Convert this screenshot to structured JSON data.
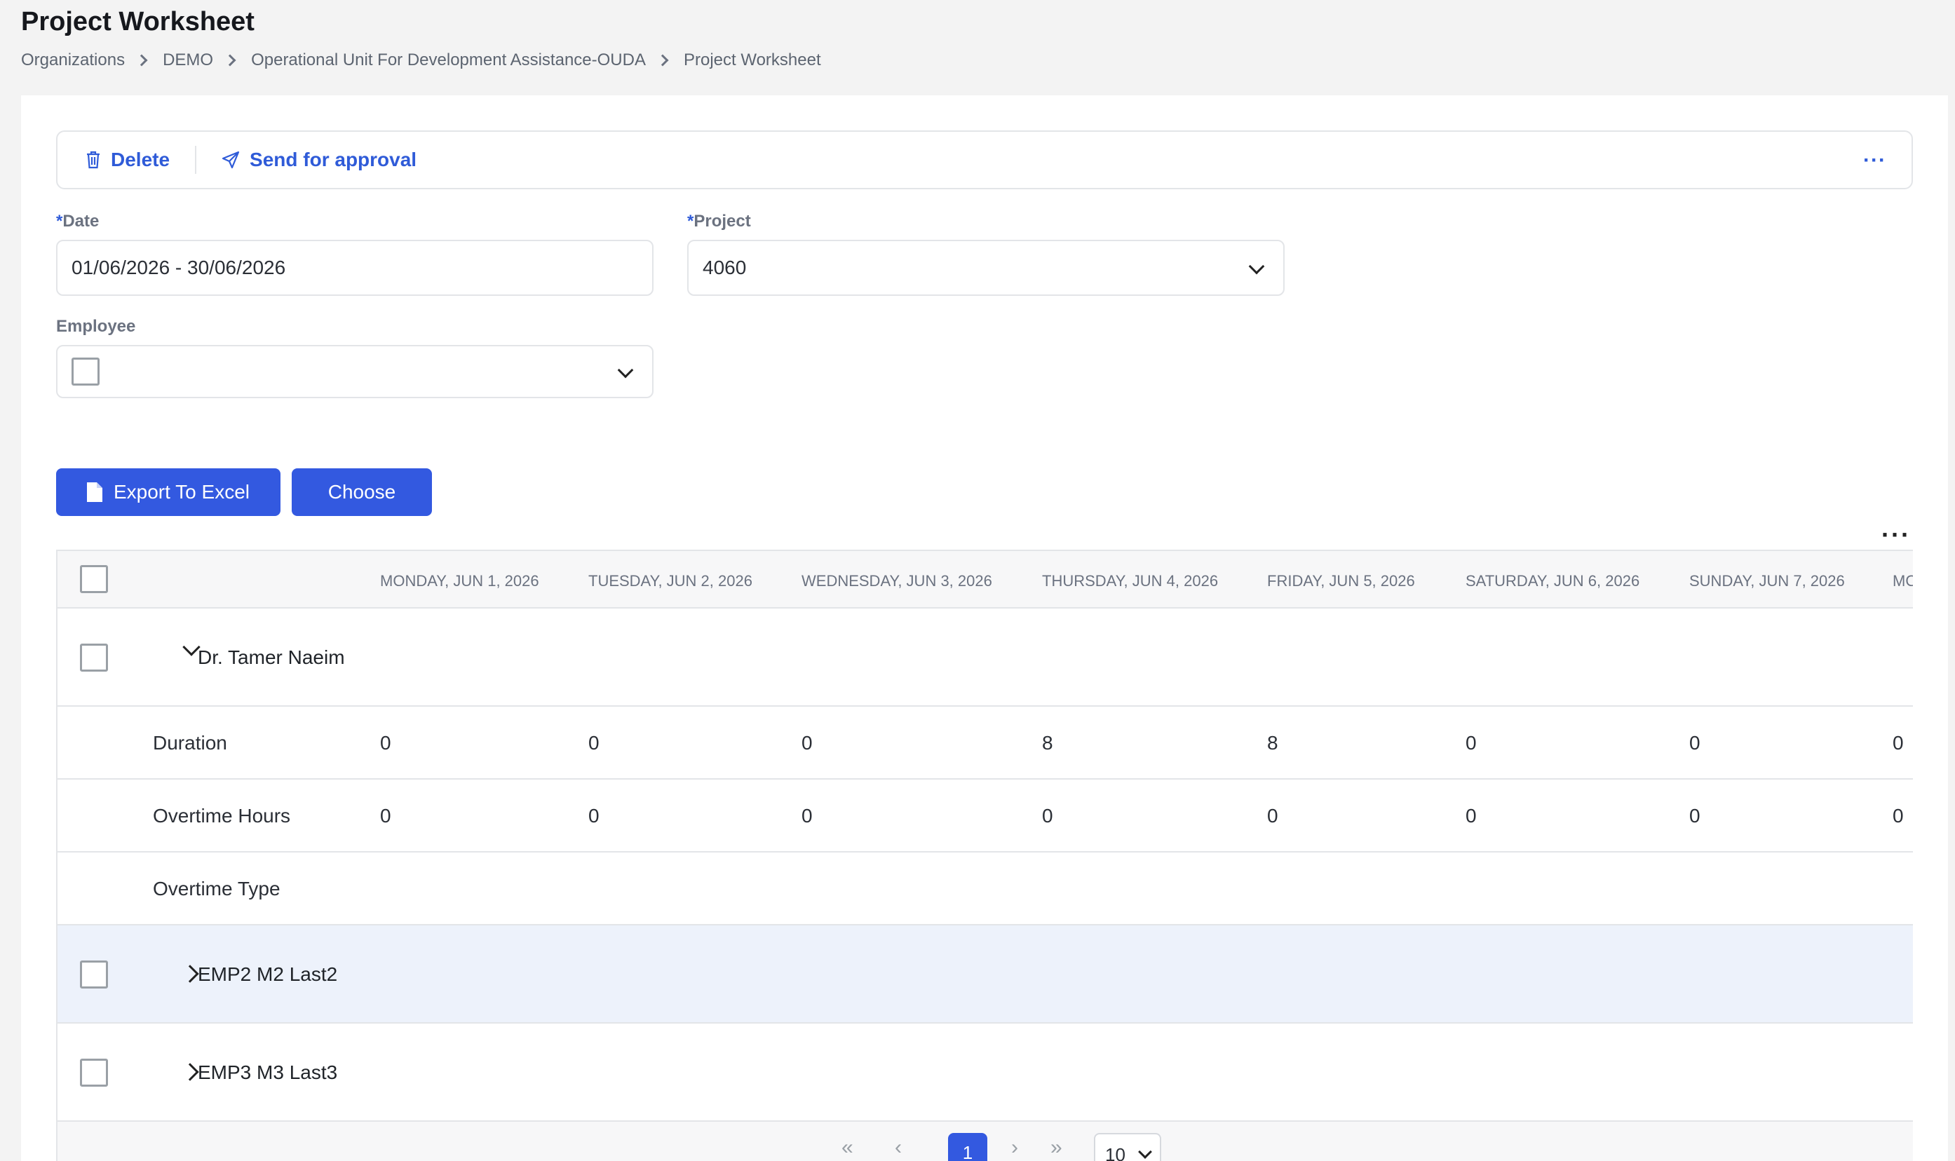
{
  "page": {
    "title": "Project Worksheet",
    "breadcrumb": [
      "Organizations",
      "DEMO",
      "Operational Unit For Development Assistance-OUDA",
      "Project Worksheet"
    ]
  },
  "toolbar": {
    "delete_label": "Delete",
    "send_label": "Send for approval",
    "more_label": "···"
  },
  "form": {
    "date": {
      "required_mark": "*",
      "label": "Date",
      "value": "01/06/2026 - 30/06/2026"
    },
    "project": {
      "required_mark": "*",
      "label": "Project",
      "value": "4060"
    },
    "employee": {
      "label": "Employee",
      "value": ""
    }
  },
  "actions": {
    "export_label": "Export To Excel",
    "choose_label": "Choose"
  },
  "grid": {
    "more_label": "···",
    "columns": [
      "MONDAY, JUN 1, 2026",
      "TUESDAY, JUN 2, 2026",
      "WEDNESDAY, JUN 3, 2026",
      "THURSDAY, JUN 4, 2026",
      "FRIDAY, JUN 5, 2026",
      "SATURDAY, JUN 6, 2026",
      "SUNDAY, JUN 7, 2026",
      "MO"
    ],
    "employees": [
      {
        "name": "Dr. Tamer Naeim",
        "expanded": true,
        "rows": [
          {
            "label": "Duration",
            "values": [
              "0",
              "0",
              "0",
              "8",
              "8",
              "0",
              "0",
              "0"
            ]
          },
          {
            "label": "Overtime Hours",
            "values": [
              "0",
              "0",
              "0",
              "0",
              "0",
              "0",
              "0",
              "0"
            ]
          },
          {
            "label": "Overtime Type",
            "values": [
              "",
              "",
              "",
              "",
              "",
              "",
              "",
              ""
            ]
          }
        ]
      },
      {
        "name": "EMP2 M2 Last2",
        "expanded": false
      },
      {
        "name": "EMP3 M3 Last3",
        "expanded": false
      }
    ]
  },
  "pagination": {
    "first": "«",
    "prev": "‹",
    "current": "1",
    "next": "›",
    "last": "»",
    "page_size": "10"
  }
}
